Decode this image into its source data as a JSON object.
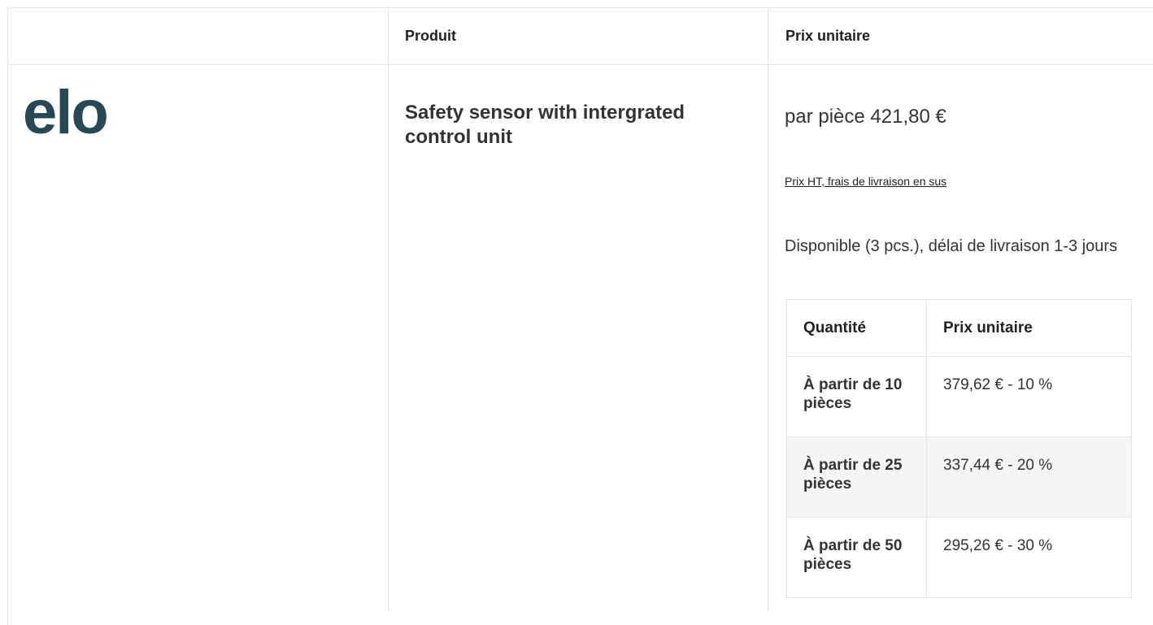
{
  "headers": {
    "product": "Produit",
    "unit_price": "Prix unitaire"
  },
  "brand": {
    "logo_text": "elo",
    "color": "#264a55"
  },
  "product": {
    "name": "Safety sensor with intergrated control unit",
    "price": "par pièce 421,80 €",
    "tax_note": "Prix HT, frais de livraison en sus",
    "availability": "Disponible (3 pcs.), délai de livraison 1-3 jours"
  },
  "tiers": {
    "columns": [
      "Quantité",
      "Prix unitaire"
    ],
    "rows": [
      {
        "quantity": "À partir de 10 pièces",
        "price": "379,62 € - 10 %"
      },
      {
        "quantity": "À partir de 25 pièces",
        "price": "337,44 € - 20 %"
      },
      {
        "quantity": "À partir de 50 pièces",
        "price": "295,26 € - 30 %"
      }
    ]
  }
}
